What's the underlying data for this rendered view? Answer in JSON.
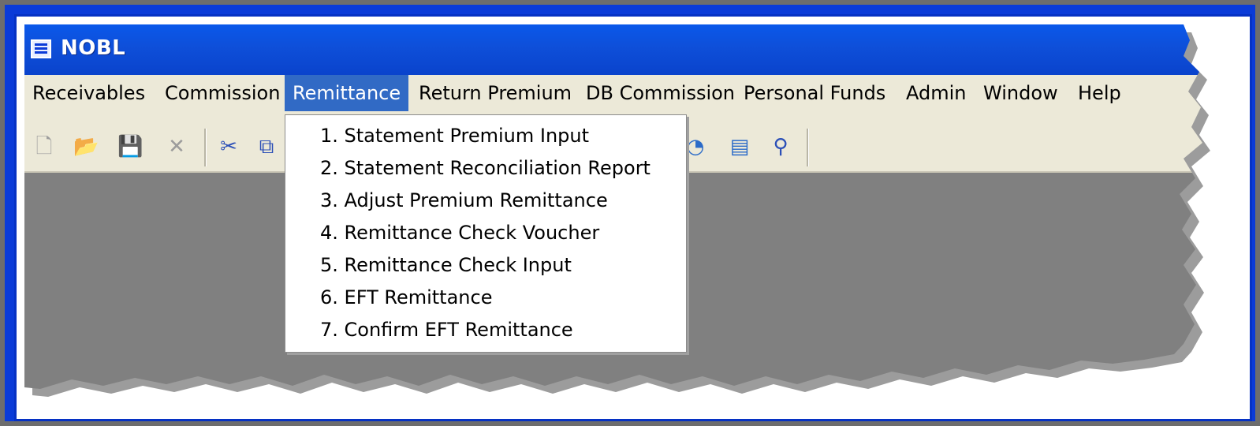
{
  "window": {
    "title": "NOBL",
    "icon": "app-window-icon"
  },
  "menubar": {
    "items": [
      {
        "label": "Receivables"
      },
      {
        "label": "Commission"
      },
      {
        "label": "Remittance",
        "active": true
      },
      {
        "label": "Return Premium"
      },
      {
        "label": "DB Commission"
      },
      {
        "label": "Personal Funds"
      },
      {
        "label": "Admin"
      },
      {
        "label": "Window"
      },
      {
        "label": "Help"
      }
    ]
  },
  "remittance_menu": {
    "items": [
      {
        "label": "1. Statement Premium Input"
      },
      {
        "label": "2. Statement Reconciliation Report"
      },
      {
        "label": "3. Adjust Premium Remittance"
      },
      {
        "label": "4. Remittance Check Voucher"
      },
      {
        "label": "5. Remittance Check Input"
      },
      {
        "label": "6. EFT Remittance"
      },
      {
        "label": "7. Confirm EFT Remittance"
      }
    ]
  },
  "toolbar": {
    "icons": [
      "new-document-icon",
      "open-folder-icon",
      "save-icon",
      "delete-icon",
      "cut-icon",
      "copy-icon",
      "chart-icon",
      "report-icon",
      "find-icon"
    ]
  },
  "colors": {
    "frame_blue": "#0a3bd8",
    "titlebar_blue": "#0a58ea",
    "menu_highlight": "#316ac5",
    "menubar_bg": "#ece9d8",
    "mdi_bg": "#808080"
  }
}
